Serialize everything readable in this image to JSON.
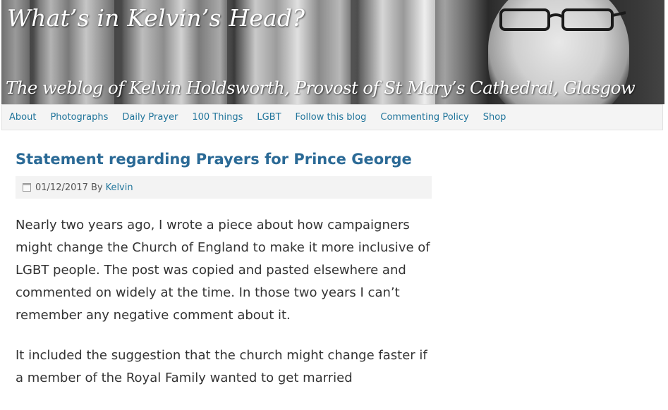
{
  "header": {
    "title": "What’s in Kelvin’s Head?",
    "tagline": "The weblog of Kelvin Holdsworth, Provost of St Mary’s Cathedral, Glasgow"
  },
  "nav": {
    "items": [
      {
        "label": "About"
      },
      {
        "label": "Photographs"
      },
      {
        "label": "Daily Prayer"
      },
      {
        "label": "100 Things"
      },
      {
        "label": "LGBT"
      },
      {
        "label": "Follow this blog"
      },
      {
        "label": "Commenting Policy"
      },
      {
        "label": "Shop"
      }
    ]
  },
  "post": {
    "title": "Statement regarding Prayers for Prince George",
    "date": "01/12/2017",
    "by_label": "By",
    "author": "Kelvin",
    "paragraphs": [
      "Nearly two years ago, I wrote a piece about how campaigners might change the Church of England to make it more inclusive of LGBT people. The post was copied and pasted elsewhere and commented on widely at the time. In those two years I can’t remember any negative comment about it.",
      "It included the suggestion that the church might change faster if a member of the Royal Family wanted to get married"
    ]
  },
  "colors": {
    "link": "#21759b",
    "title": "#2b6a96",
    "nav_bg": "#f4f4f4",
    "meta_bg": "#f3f3f3",
    "body_text": "#333333"
  }
}
